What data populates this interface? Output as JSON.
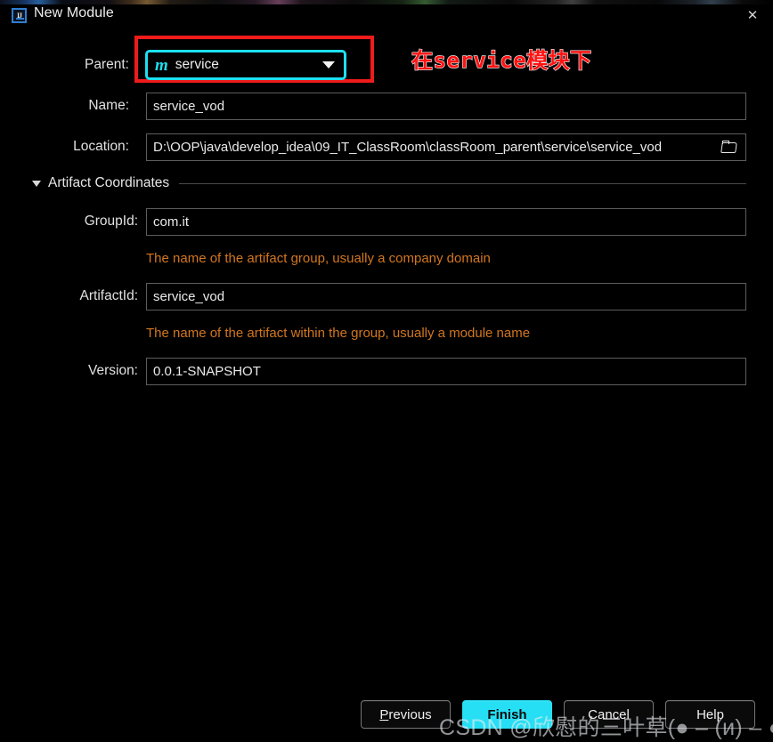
{
  "window": {
    "title": "New Module",
    "app_icon": "intellij-idea-icon",
    "close_label": "✕"
  },
  "form": {
    "parent": {
      "label": "Parent:",
      "value": "service",
      "icon": "maven-module-icon",
      "icon_glyph": "m",
      "highlight_color": "#ef1b1b",
      "focus_color": "#1ee0f0"
    },
    "name": {
      "label": "Name:",
      "value": "service_vod"
    },
    "location": {
      "label": "Location:",
      "value": "D:\\OOP\\java\\develop_idea\\09_IT_ClassRoom\\classRoom_parent\\service\\service_vod",
      "browse_icon": "folder-icon"
    },
    "artifact_section": {
      "title": "Artifact Coordinates",
      "expanded": true
    },
    "group_id": {
      "label": "GroupId:",
      "value": "com.it",
      "hint": "The name of the artifact group, usually a company domain"
    },
    "artifact_id": {
      "label": "ArtifactId:",
      "value": "service_vod",
      "hint": "The name of the artifact within the group, usually a module name"
    },
    "version": {
      "label": "Version:",
      "value": "0.0.1-SNAPSHOT"
    },
    "hint_color": "#d2761f"
  },
  "annotation": {
    "text": "在service模块下",
    "color": "#ff1212"
  },
  "buttons": {
    "previous": {
      "prefix": "P",
      "rest": "revious"
    },
    "finish": {
      "label": "Finish",
      "accent": "#26dff5"
    },
    "cancel": {
      "label": "Cancel"
    },
    "help": {
      "label": "Help"
    }
  },
  "watermark": {
    "text": "CSDN @欣慰的三叶草(● – (и) – ●)"
  }
}
